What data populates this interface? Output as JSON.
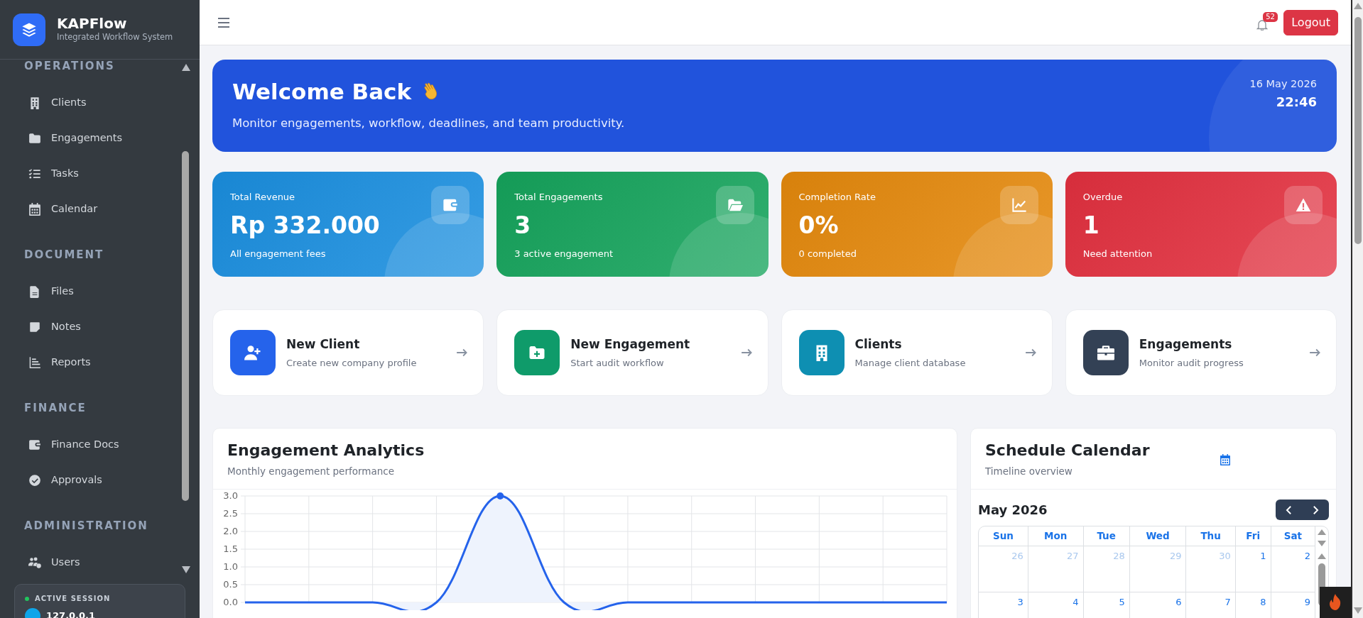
{
  "brand": {
    "name": "KAPFlow",
    "tagline": "Integrated Workflow System"
  },
  "sidebar": {
    "sections": [
      {
        "title": "OPERATIONS",
        "items": [
          {
            "label": "Clients"
          },
          {
            "label": "Engagements"
          },
          {
            "label": "Tasks"
          },
          {
            "label": "Calendar"
          }
        ]
      },
      {
        "title": "DOCUMENT",
        "items": [
          {
            "label": "Files"
          },
          {
            "label": "Notes"
          },
          {
            "label": "Reports"
          }
        ]
      },
      {
        "title": "FINANCE",
        "items": [
          {
            "label": "Finance Docs"
          },
          {
            "label": "Approvals"
          }
        ]
      },
      {
        "title": "ADMINISTRATION",
        "items": [
          {
            "label": "Users"
          }
        ]
      }
    ]
  },
  "session": {
    "label": "ACTIVE SESSION",
    "address": "127.0.0.1"
  },
  "topbar": {
    "notifications": "52",
    "logout": "Logout"
  },
  "welcome": {
    "title": "Welcome Back",
    "text": "Monitor engagements, workflow, deadlines, and team productivity.",
    "date": "16 May 2026",
    "time": "22:46"
  },
  "stats": [
    {
      "label": "Total Revenue",
      "value": "Rp 332.000",
      "note": "All engagement fees",
      "color": "#1a8fe0"
    },
    {
      "label": "Total Engagements",
      "value": "3",
      "note": "3 active engagement",
      "color": "#15a45c"
    },
    {
      "label": "Completion Rate",
      "value": "0%",
      "note": "0 completed",
      "color": "#e5890c"
    },
    {
      "label": "Overdue",
      "value": "1",
      "note": "Need attention",
      "color": "#e3303f"
    }
  ],
  "quick_actions": [
    {
      "title": "New Client",
      "text": "Create new company profile",
      "color": "#2563eb"
    },
    {
      "title": "New Engagement",
      "text": "Start audit workflow",
      "color": "#0f9b6a"
    },
    {
      "title": "Clients",
      "text": "Manage client database",
      "color": "#0e8fb2"
    },
    {
      "title": "Engagements",
      "text": "Monitor audit progress",
      "color": "#334155"
    }
  ],
  "analytics": {
    "title": "Engagement Analytics",
    "subtitle": "Monthly engagement performance",
    "chart_data": {
      "type": "area",
      "grid": true,
      "ylim": [
        0,
        3
      ],
      "values": [
        0,
        0,
        0,
        0,
        3,
        0,
        0,
        0,
        0,
        0,
        0,
        0
      ],
      "yticks": [
        {
          "value": 0,
          "label": "0.0"
        },
        {
          "value": 0.5,
          "label": "0.5"
        },
        {
          "value": 1,
          "label": "1.0"
        },
        {
          "value": 1.5,
          "label": "1.5"
        },
        {
          "value": 2,
          "label": "2.0"
        },
        {
          "value": 2.5,
          "label": "2.5"
        },
        {
          "value": 3,
          "label": "3.0"
        }
      ]
    }
  },
  "calendar": {
    "title": "Schedule Calendar",
    "subtitle": "Timeline overview",
    "month": "May 2026",
    "weekdays": [
      "Sun",
      "Mon",
      "Tue",
      "Wed",
      "Thu",
      "Fri",
      "Sat"
    ],
    "weeks": [
      [
        {
          "day": "26",
          "other_month": true
        },
        {
          "day": "27",
          "other_month": true
        },
        {
          "day": "28",
          "other_month": true
        },
        {
          "day": "29",
          "other_month": true
        },
        {
          "day": "30",
          "other_month": true
        },
        {
          "day": "1",
          "other_month": false
        },
        {
          "day": "2",
          "other_month": false
        }
      ],
      [
        {
          "day": "3",
          "other_month": false
        },
        {
          "day": "4",
          "other_month": false
        },
        {
          "day": "5",
          "other_month": false
        },
        {
          "day": "6",
          "other_month": false
        },
        {
          "day": "7",
          "other_month": false
        },
        {
          "day": "8",
          "other_month": false
        },
        {
          "day": "9",
          "other_month": false
        }
      ]
    ]
  }
}
